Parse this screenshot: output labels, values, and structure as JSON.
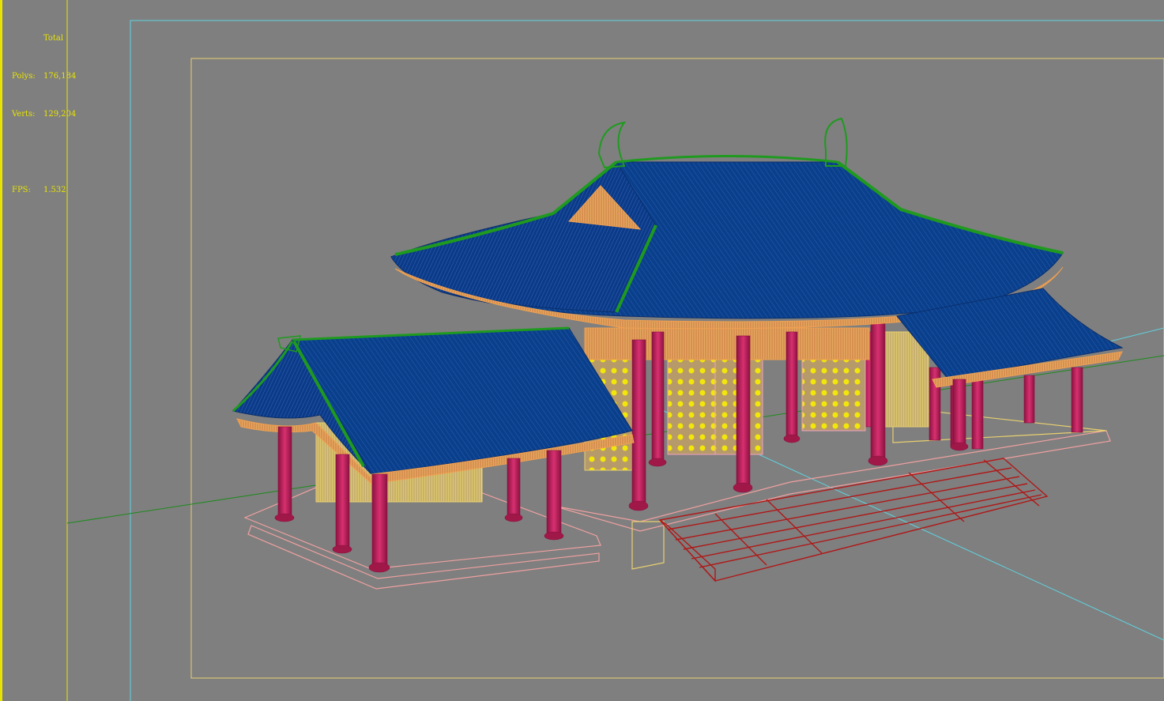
{
  "viewport": {
    "background": "#7f7f7f",
    "active_border_color": "#e8e400",
    "safe_frame_outer_color": "#5fd3e0",
    "safe_frame_inner_color": "#e8d070"
  },
  "stats": {
    "total_label": "Total",
    "polys_label": "Polys:",
    "polys_value": "176,184",
    "verts_label": "Verts:",
    "verts_value": "129,204",
    "fps_label": "FPS:",
    "fps_value": "1.532",
    "color": "#e8e400"
  },
  "model": {
    "subject": "chinese-pavilion-wireframe",
    "roof_color": "#0a3f8c",
    "roof_ridge_color": "#1f9a1f",
    "column_color": "#c8245c",
    "door_color": "#f2e60a",
    "stair_color": "#b01818",
    "platform_color": "#f0a0a0",
    "eave_color": "#f0a050"
  },
  "axes": {
    "x_color": "#1c8a1c",
    "y_color": "#5fd3e0"
  }
}
